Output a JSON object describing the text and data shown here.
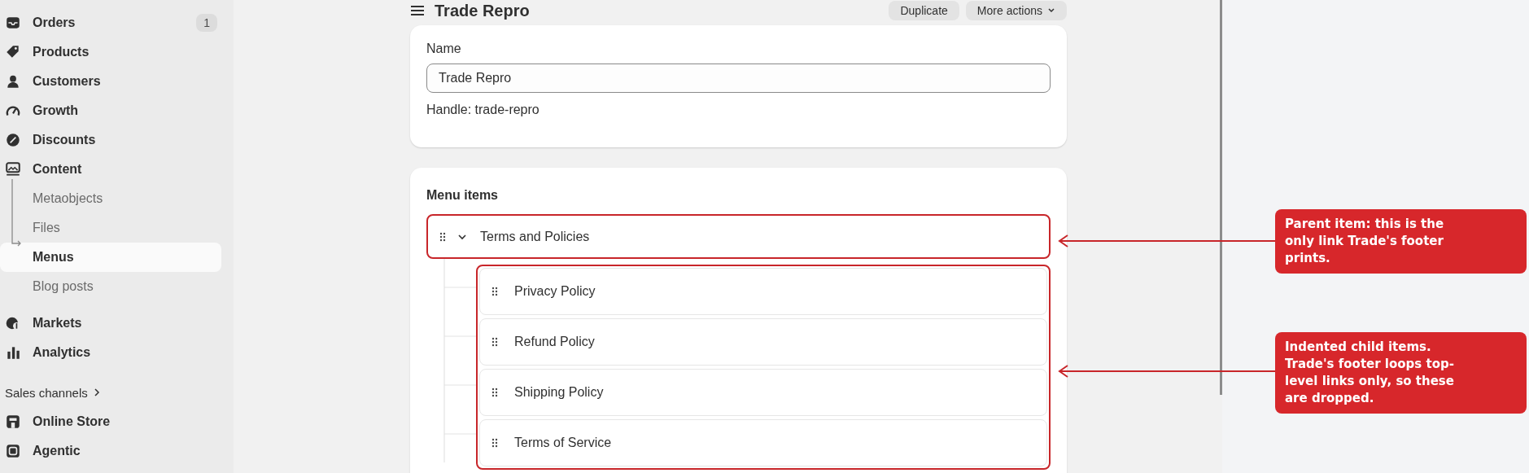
{
  "sidebar": {
    "items": [
      {
        "label": "Orders",
        "badge": "1",
        "selected": false
      },
      {
        "label": "Products",
        "selected": false
      },
      {
        "label": "Customers",
        "selected": false
      },
      {
        "label": "Growth",
        "selected": false
      },
      {
        "label": "Discounts",
        "selected": false
      },
      {
        "label": "Content",
        "selected": false,
        "children": [
          {
            "label": "Metaobjects",
            "selected": false
          },
          {
            "label": "Files",
            "selected": false
          },
          {
            "label": "Menus",
            "selected": true
          },
          {
            "label": "Blog posts",
            "selected": false
          }
        ]
      },
      {
        "label": "Markets",
        "selected": false
      },
      {
        "label": "Analytics",
        "selected": false
      }
    ],
    "sales_channels": {
      "heading": "Sales channels",
      "items": [
        {
          "label": "Online Store",
          "selected": false
        },
        {
          "label": "Agentic",
          "selected": false
        }
      ]
    }
  },
  "header": {
    "title": "Trade Repro",
    "actions": [
      "Duplicate",
      "More actions"
    ]
  },
  "name_card": {
    "label": "Name",
    "value": "Trade Repro",
    "handle": "Handle: trade-repro"
  },
  "menu_card": {
    "heading": "Menu items",
    "items": [
      {
        "label": "Terms and Policies",
        "expanded": true,
        "children": [
          {
            "label": "Privacy Policy"
          },
          {
            "label": "Refund Policy"
          },
          {
            "label": "Shipping Policy"
          },
          {
            "label": "Terms of Service"
          }
        ]
      }
    ]
  },
  "annotations": [
    {
      "text": "Parent item: this is the only link Trade's footer prints."
    },
    {
      "text": "Indented child items. Trade's footer loops top-level links only, so these are dropped."
    }
  ]
}
